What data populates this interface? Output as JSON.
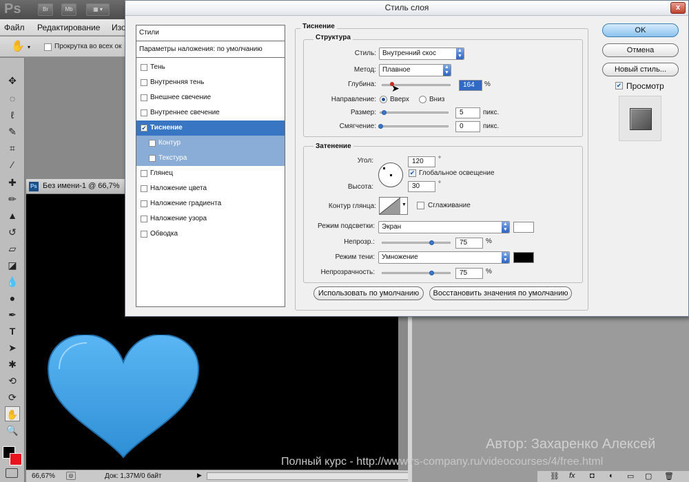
{
  "app": {
    "logo": "Ps",
    "top_buttons": [
      "Br",
      "Mb"
    ],
    "menu": [
      "Файл",
      "Редактирование",
      "Изо"
    ],
    "options_checkbox_label": "Прокрутка во всех ок"
  },
  "document": {
    "title": "Без имени-1 @ 66,7%",
    "zoom": "66,67%",
    "doc_info": "Док: 1,37M/0 байт",
    "heart_color": "#3ea1ea"
  },
  "dialog": {
    "title": "Стиль слоя",
    "close_label": "x",
    "styles_header": "Стили",
    "blending_options": "Параметры наложения: по умолчанию",
    "styles": [
      {
        "label": "Тень",
        "checked": false
      },
      {
        "label": "Внутренняя тень",
        "checked": false
      },
      {
        "label": "Внешнее свечение",
        "checked": false
      },
      {
        "label": "Внутреннее свечение",
        "checked": false
      },
      {
        "label": "Тиснение",
        "checked": true
      },
      {
        "label": "Контур",
        "checked": false
      },
      {
        "label": "Текстура",
        "checked": false
      },
      {
        "label": "Глянец",
        "checked": false
      },
      {
        "label": "Наложение цвета",
        "checked": false
      },
      {
        "label": "Наложение градиента",
        "checked": false
      },
      {
        "label": "Наложение узора",
        "checked": false
      },
      {
        "label": "Обводка",
        "checked": false
      }
    ],
    "bevel": {
      "section_title": "Тиснение",
      "structure_title": "Структура",
      "style_label": "Стиль:",
      "style_value": "Внутренний скос",
      "method_label": "Метод:",
      "method_value": "Плавное",
      "depth_label": "Глубина:",
      "depth_value": "164",
      "depth_unit": "%",
      "direction_label": "Направление:",
      "direction_up": "Вверх",
      "direction_down": "Вниз",
      "size_label": "Размер:",
      "size_value": "5",
      "size_unit": "пикс.",
      "soften_label": "Смягчение:",
      "soften_value": "0",
      "soften_unit": "пикс."
    },
    "shading": {
      "title": "Затенение",
      "angle_label": "Угол:",
      "angle_value": "120",
      "degree": "°",
      "global_light": "Глобальное освещение",
      "altitude_label": "Высота:",
      "altitude_value": "30",
      "gloss_label": "Контур глянца:",
      "antialias": "Сглаживание",
      "highlight_mode_label": "Режим подсветки:",
      "highlight_mode_value": "Экран",
      "highlight_color": "#ffffff",
      "highlight_opacity_label": "Непрозр.:",
      "highlight_opacity_value": "75",
      "percent": "%",
      "shadow_mode_label": "Режим тени:",
      "shadow_mode_value": "Умножение",
      "shadow_color": "#000000",
      "shadow_opacity_label": "Непрозрачность:",
      "shadow_opacity_value": "75"
    },
    "make_default": "Использовать по умолчанию",
    "reset_default": "Восстановить значения по умолчанию",
    "ok": "OK",
    "cancel": "Отмена",
    "new_style": "Новый стиль...",
    "preview_label": "Просмотр"
  },
  "watermark": {
    "author": "Автор: Захаренко Алексей",
    "course": "Полный курс - http://www.rs-company.ru/videocourses/4/free.html"
  }
}
